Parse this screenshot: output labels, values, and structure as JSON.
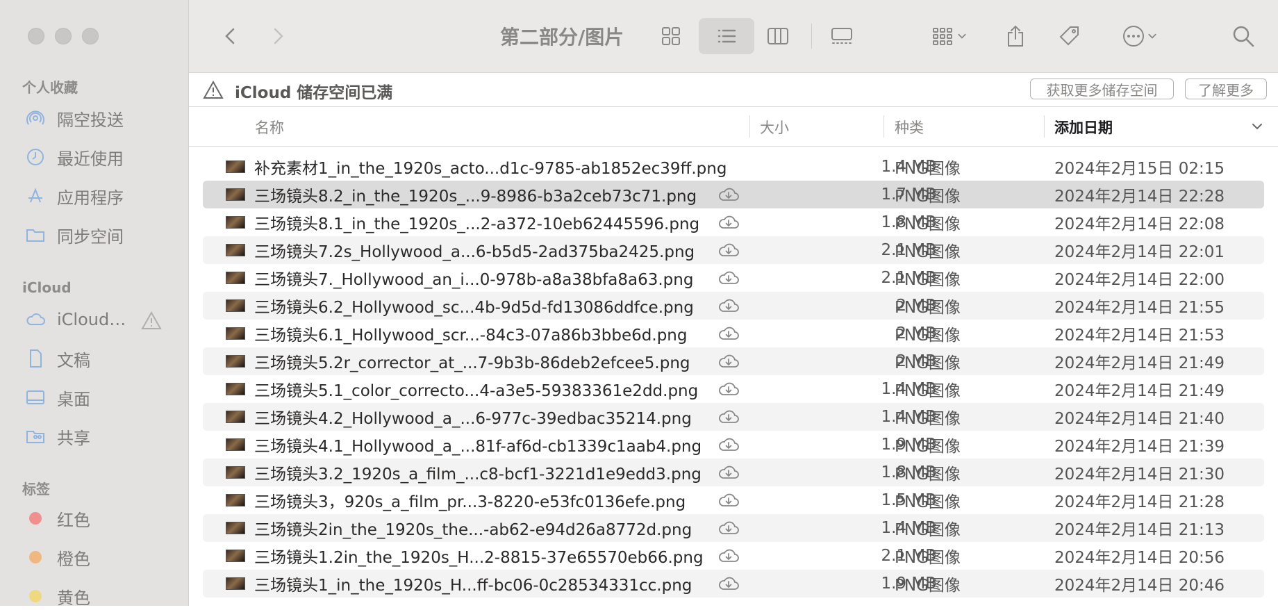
{
  "toolbar": {
    "title": "第二部分/图片"
  },
  "sidebar": {
    "favorites_title": "个人收藏",
    "favorites": [
      {
        "label": "隔空投送",
        "icon": "airdrop-icon"
      },
      {
        "label": "最近使用",
        "icon": "clock-icon"
      },
      {
        "label": "应用程序",
        "icon": "apps-icon"
      },
      {
        "label": "同步空间",
        "icon": "folder-icon"
      }
    ],
    "icloud_title": "iCloud",
    "icloud": [
      {
        "label": "iCloud…",
        "icon": "cloud-icon"
      },
      {
        "label": "文稿",
        "icon": "document-icon"
      },
      {
        "label": "桌面",
        "icon": "desktop-icon"
      },
      {
        "label": "共享",
        "icon": "shared-folder-icon"
      }
    ],
    "tags_title": "标签",
    "tags": [
      {
        "label": "红色",
        "color": "#f0908e"
      },
      {
        "label": "橙色",
        "color": "#f0b880"
      },
      {
        "label": "黄色",
        "color": "#f0d880"
      }
    ]
  },
  "banner": {
    "text": "iCloud 储存空间已满",
    "get_more": "获取更多储存空间",
    "learn_more": "了解更多"
  },
  "columns": {
    "name": "名称",
    "size": "大小",
    "kind": "种类",
    "date_added": "添加日期"
  },
  "files": [
    {
      "name": "补充素材1_in_the_1920s_acto...d1c-9785-ab1852ec39ff.png",
      "size": "1.4 MB",
      "kind": "PNG图像",
      "date": "2024年2月15日 02:15",
      "cloud": false
    },
    {
      "name": "三场镜头8.2_in_the_1920s_...9-8986-b3a2ceb73c71.png",
      "size": "1.7 MB",
      "kind": "PNG图像",
      "date": "2024年2月14日 22:28",
      "cloud": true
    },
    {
      "name": "三场镜头8.1_in_the_1920s_...2-a372-10eb62445596.png",
      "size": "1.8 MB",
      "kind": "PNG图像",
      "date": "2024年2月14日 22:08",
      "cloud": true
    },
    {
      "name": "三场镜头7.2s_Hollywood_a...6-b5d5-2ad375ba2425.png",
      "size": "2.1 MB",
      "kind": "PNG图像",
      "date": "2024年2月14日 22:01",
      "cloud": true
    },
    {
      "name": "三场镜头7._Hollywood_an_i...0-978b-a8a38bfa8a63.png",
      "size": "2.1 MB",
      "kind": "PNG图像",
      "date": "2024年2月14日 22:00",
      "cloud": true
    },
    {
      "name": "三场镜头6.2_Hollywood_sc...4b-9d5d-fd13086ddfce.png",
      "size": "2 MB",
      "kind": "PNG图像",
      "date": "2024年2月14日 21:55",
      "cloud": true
    },
    {
      "name": "三场镜头6.1_Hollywood_scr...-84c3-07a86b3bbe6d.png",
      "size": "2 MB",
      "kind": "PNG图像",
      "date": "2024年2月14日 21:53",
      "cloud": true
    },
    {
      "name": "三场镜头5.2r_corrector_at_...7-9b3b-86deb2efcee5.png",
      "size": "2 MB",
      "kind": "PNG图像",
      "date": "2024年2月14日 21:49",
      "cloud": true
    },
    {
      "name": "三场镜头5.1_color_correcto...4-a3e5-59383361e2dd.png",
      "size": "1.4 MB",
      "kind": "PNG图像",
      "date": "2024年2月14日 21:49",
      "cloud": true
    },
    {
      "name": "三场镜头4.2_Hollywood_a_...6-977c-39edbac35214.png",
      "size": "1.4 MB",
      "kind": "PNG图像",
      "date": "2024年2月14日 21:40",
      "cloud": true
    },
    {
      "name": "三场镜头4.1_Hollywood_a_...81f-af6d-cb1339c1aab4.png",
      "size": "1.9 MB",
      "kind": "PNG图像",
      "date": "2024年2月14日 21:39",
      "cloud": true
    },
    {
      "name": "三场镜头3.2_1920s_a_film_...c8-bcf1-3221d1e9edd3.png",
      "size": "1.8 MB",
      "kind": "PNG图像",
      "date": "2024年2月14日 21:30",
      "cloud": true
    },
    {
      "name": "三场镜头3，920s_a_film_pr...3-8220-e53fc0136efe.png",
      "size": "1.5 MB",
      "kind": "PNG图像",
      "date": "2024年2月14日 21:28",
      "cloud": true
    },
    {
      "name": "三场镜头2in_the_1920s_the...-ab62-e94d26a8772d.png",
      "size": "1.4 MB",
      "kind": "PNG图像",
      "date": "2024年2月14日 21:13",
      "cloud": true
    },
    {
      "name": "三场镜头1.2in_the_1920s_H...2-8815-37e65570eb66.png",
      "size": "2.1 MB",
      "kind": "PNG图像",
      "date": "2024年2月14日 20:56",
      "cloud": true
    },
    {
      "name": "三场镜头1_in_the_1920s_H...ff-bc06-0c28534331cc.png",
      "size": "1.9 MB",
      "kind": "PNG图像",
      "date": "2024年2月14日 20:46",
      "cloud": true
    }
  ],
  "selected_index": 1
}
